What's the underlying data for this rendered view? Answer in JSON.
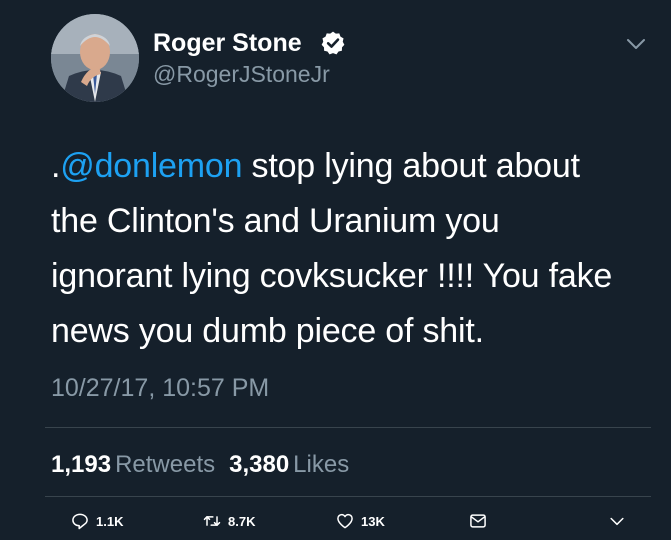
{
  "user": {
    "display_name": "Roger Stone",
    "handle": "@RogerJStoneJr",
    "verified": true
  },
  "tweet": {
    "text_lines": [
      {
        "prefix": ".",
        "mention": "@donlemon",
        "rest": " stop lying about about"
      },
      {
        "text": "the Clinton's and Uranium you"
      },
      {
        "text": "ignorant lying covksucker !!!! You fake"
      },
      {
        "text": "news you dumb piece of shit."
      }
    ],
    "timestamp": "10/27/17, 10:57 PM"
  },
  "stats": {
    "retweets_count": "1,193",
    "retweets_label": "Retweets",
    "likes_count": "3,380",
    "likes_label": "Likes"
  },
  "actions": {
    "reply_count": "1.1K",
    "retweet_count": "8.7K",
    "like_count": "13K",
    "icons": [
      "reply-icon",
      "retweet-icon",
      "like-icon",
      "mail-icon",
      "chevron-down-icon"
    ]
  },
  "colors": {
    "background": "#15202b",
    "text_primary": "#ffffff",
    "text_secondary": "#8899a6",
    "accent": "#1da1f2",
    "divider": "#38444d"
  }
}
